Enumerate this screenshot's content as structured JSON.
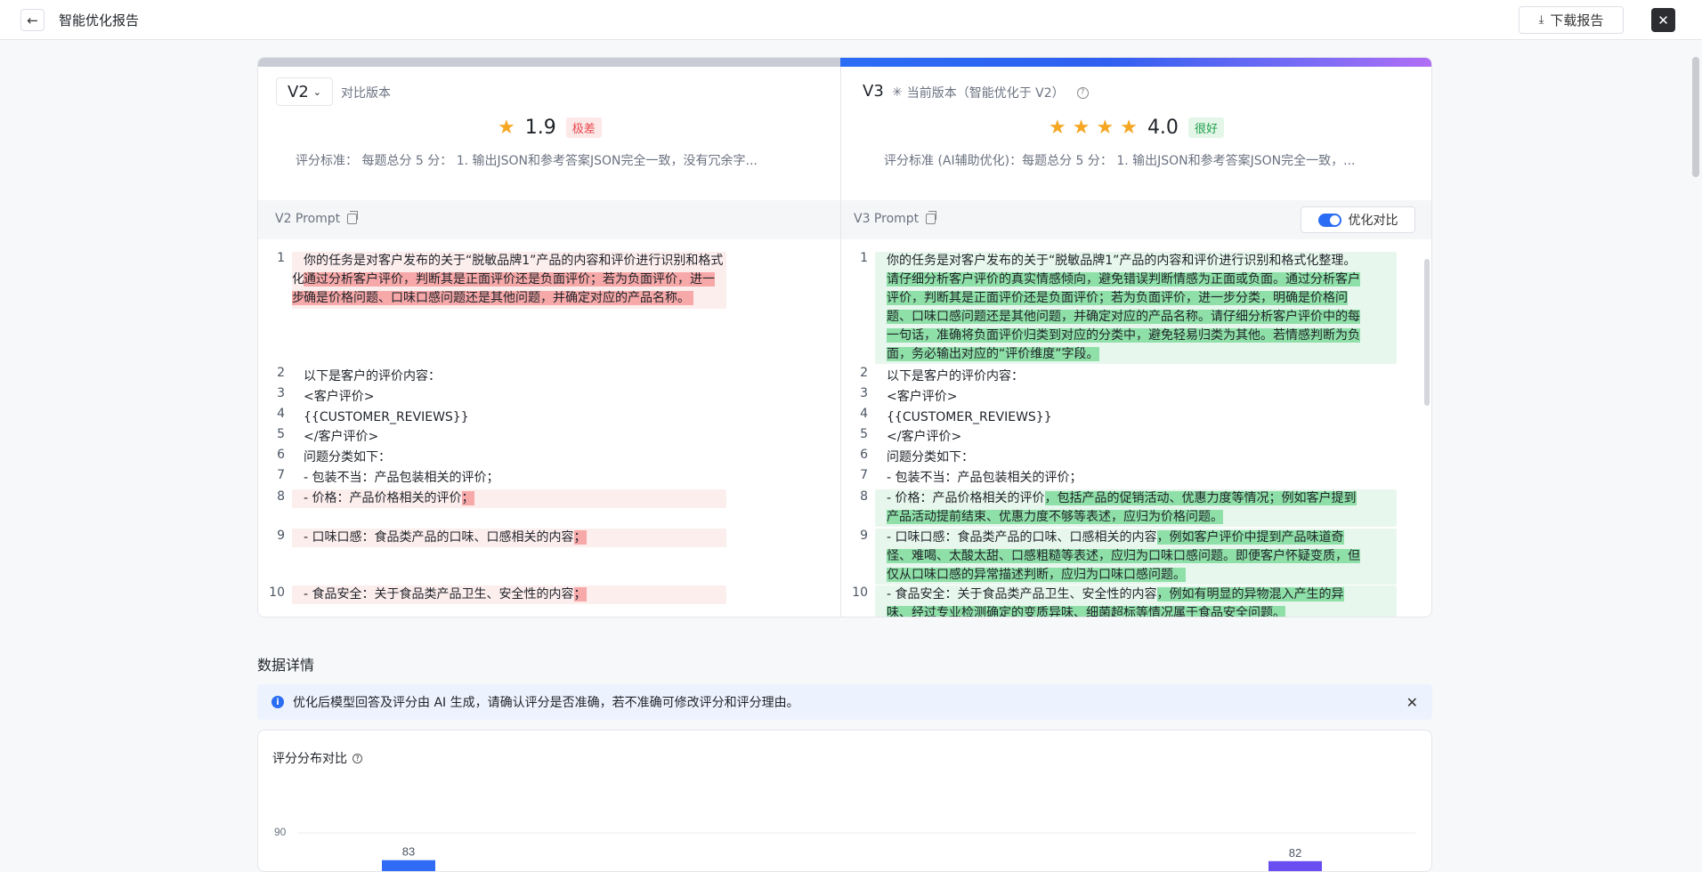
{
  "header": {
    "title": "智能优化报告",
    "download_label": "下载报告"
  },
  "left": {
    "version": "V2",
    "version_sub": "对比版本",
    "score": "1.9",
    "rating_tag": "极差",
    "stars": 1,
    "criteria": "评分标准： 每题总分 5 分： 1. 输出JSON和参考答案JSON完全一致，没有冗余字...",
    "prompt_label": "V2 Prompt",
    "lines": [
      {
        "num": "1",
        "rows": [
          {
            "text": "你的任务是对客户发布的关于“脱敏品牌1”产品的内容和评价进行识别和格式化整理。",
            "hl": ""
          },
          {
            "text": "通过分析客户评价，判断其是正面评价还是负面评价；若为负面评价，进一步分类，明",
            "hl": "del"
          },
          {
            "text": "确是价格问题、口味口感问题还是其他问题，并确定对应的产品名称。",
            "hl": "del"
          }
        ]
      },
      {
        "num": "2",
        "text": "以下是客户的评价内容："
      },
      {
        "num": "3",
        "text": "<客户评价>"
      },
      {
        "num": "4",
        "text": "{{CUSTOMER_REVIEWS}}"
      },
      {
        "num": "5",
        "text": "</客户评价>"
      },
      {
        "num": "6",
        "text": "问题分类如下："
      },
      {
        "num": "7",
        "text": "- 包装不当：产品包装相关的评价；"
      },
      {
        "num": "8",
        "text": "- 价格：产品价格相关的评价",
        "tail": "；"
      },
      {
        "num": "9",
        "text": "- 口味口感：食品类产品的口味、口感相关的内容",
        "tail": "；"
      },
      {
        "num": "10",
        "text": "- 食品安全：关于食品类产品卫生、安全性的内容",
        "tail": "；"
      }
    ]
  },
  "right": {
    "version": "V3",
    "version_sub": "当前版本（智能优化于 V2）",
    "score": "4.0",
    "rating_tag": "很好",
    "stars": 4,
    "criteria": "评分标准 (AI辅助优化)：每题总分 5 分： 1. 输出JSON和参考答案JSON完全一致，...",
    "prompt_label": "V3 Prompt",
    "toggle_label": "优化对比",
    "lines": [
      {
        "num": "1",
        "rows": [
          "你的任务是对客户发布的关于“脱敏品牌1”产品的内容和评价进行识别和格式化整理。",
          "请仔细分析客户评价的真实情感倾向，避免错误判断情感为正面或负面。通过分析客户",
          "评价，判断其是正面评价还是负面评价；若为负面评价，进一步分类，明确是价格问",
          "题、口味口感问题还是其他问题，并确定对应的产品名称。请仔细分析客户评价中的每",
          "一句话，准确将负面评价归类到对应的分类中，避免轻易归类为其他。若情感判断为负",
          "面，务必输出对应的“评价维度”字段。"
        ]
      },
      {
        "num": "2",
        "text": "以下是客户的评价内容："
      },
      {
        "num": "3",
        "text": "<客户评价>"
      },
      {
        "num": "4",
        "text": "{{CUSTOMER_REVIEWS}}"
      },
      {
        "num": "5",
        "text": "</客户评价>"
      },
      {
        "num": "6",
        "text": "问题分类如下："
      },
      {
        "num": "7",
        "text": "- 包装不当：产品包装相关的评价；"
      },
      {
        "num": "8",
        "head": "- 价格：产品价格相关的评价",
        "rows": [
          "，包括产品的促销活动、优惠力度等情况；例如客户提到",
          "产品活动提前结束、优惠力度不够等表述，应归为价格问题。"
        ]
      },
      {
        "num": "9",
        "head": "- 口味口感：食品类产品的口味、口感相关的内容",
        "rows": [
          "，例如客户评价中提到产品味道奇",
          "怪、难喝、太酸太甜、口感粗糙等表述，应归为口味口感问题。即便客户怀疑变质，但",
          "仅从口味口感的异常描述判断，应归为口味口感问题。"
        ]
      },
      {
        "num": "10",
        "head": "- 食品安全：关于食品类产品卫生、安全性的内容",
        "rows": [
          "，例如有明显的异物混入产生的异",
          "味、经过专业检测确定的变质异味、细菌超标等情况属于食品安全问题。"
        ]
      }
    ]
  },
  "details": {
    "section_title": "数据详情",
    "info_text": "优化后模型回答及评分由 AI 生成，请确认评分是否准确，若不准确可修改评分和评分理由。"
  },
  "chart_data": {
    "type": "bar",
    "title": "评分分布对比",
    "y_tick_top": "90",
    "series": [
      {
        "values": [
          83
        ],
        "color": "#2f6bf5"
      },
      {
        "values": [
          82
        ],
        "color": "#6a4ef2"
      }
    ],
    "value_labels": [
      "83",
      "82"
    ]
  },
  "colors": {
    "accent": "#2a6df4",
    "del_bg": "#fdeeee",
    "del_hl": "#f7a8a8",
    "add_bg": "#e8f7ed",
    "add_hl": "#8fe0a8",
    "star": "#f5a623"
  }
}
